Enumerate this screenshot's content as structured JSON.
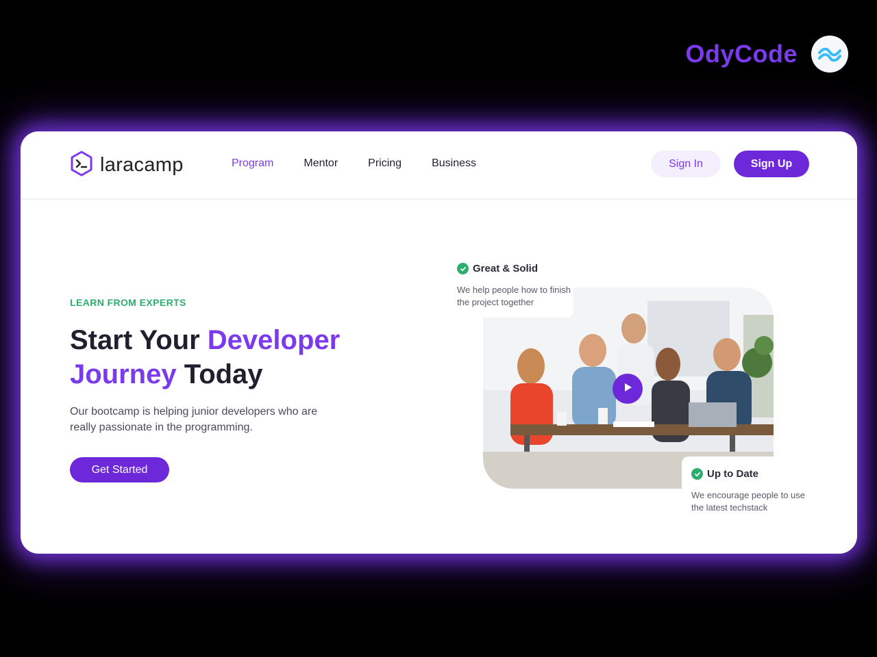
{
  "brand": {
    "name": "OdyCode",
    "logo_icon": "wave-icon"
  },
  "navbar": {
    "logo_text": "laracamp",
    "logo_icon": "terminal-hexagon-icon",
    "links": [
      {
        "label": "Program",
        "active": true
      },
      {
        "label": "Mentor",
        "active": false
      },
      {
        "label": "Pricing",
        "active": false
      },
      {
        "label": "Business",
        "active": false
      }
    ],
    "sign_in_label": "Sign In",
    "sign_up_label": "Sign Up"
  },
  "hero": {
    "eyebrow": "LEARN FROM EXPERTS",
    "headline_part1": "Start Your ",
    "headline_accent1": "Developer",
    "headline_accent2": "Journey",
    "headline_part2": " Today",
    "description": "Our bootcamp is helping junior developers who are really passionate in the programming.",
    "cta_label": "Get Started"
  },
  "features": [
    {
      "title": "Great & Solid",
      "text": "We help people how to finish the project together"
    },
    {
      "title": "Up to Date",
      "text": "We encourage people to use the latest techstack"
    }
  ],
  "colors": {
    "accent": "#7c3aed",
    "accent_dark": "#6d28d9",
    "green": "#2eae6e",
    "glow": "#7c3aed"
  }
}
